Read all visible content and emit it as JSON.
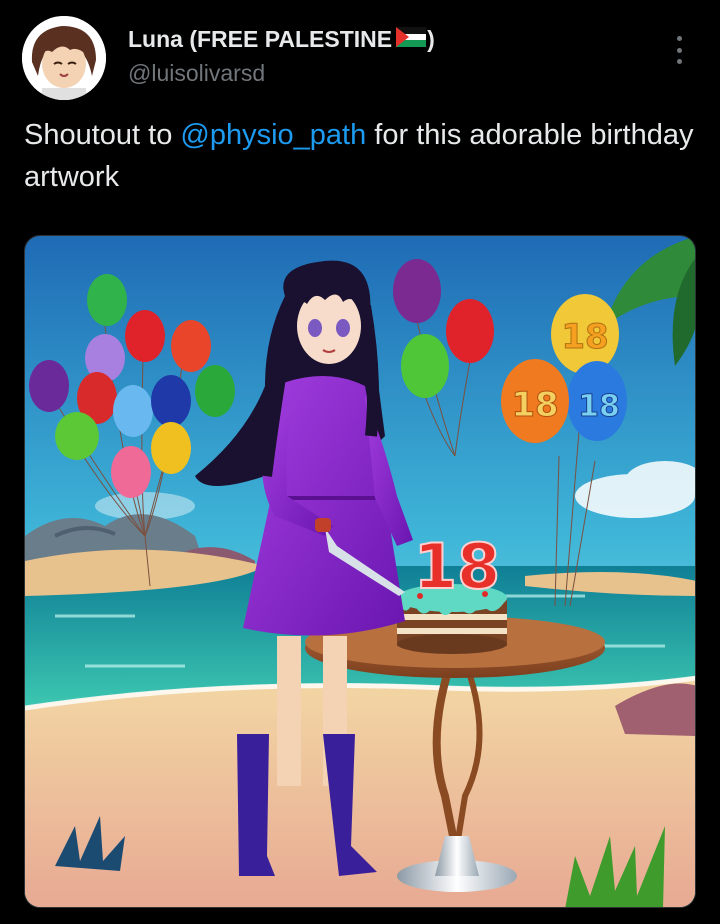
{
  "author": {
    "name": "Luna (FREE PALESTINE",
    "name_suffix": ")",
    "flag_icon": "palestine-flag-icon",
    "handle": "@luisolivarsd"
  },
  "tweet": {
    "text_before": "Shoutout to ",
    "mention": "@physio_path",
    "text_after": " for this adorable birthday artwork"
  },
  "media": {
    "description_icon": "birthday-artwork-image",
    "balloon_number": "18",
    "candle_number": "18"
  },
  "colors": {
    "background": "#000000",
    "text": "#e7e9ea",
    "secondary": "#71767b",
    "link": "#1d9bf0"
  }
}
